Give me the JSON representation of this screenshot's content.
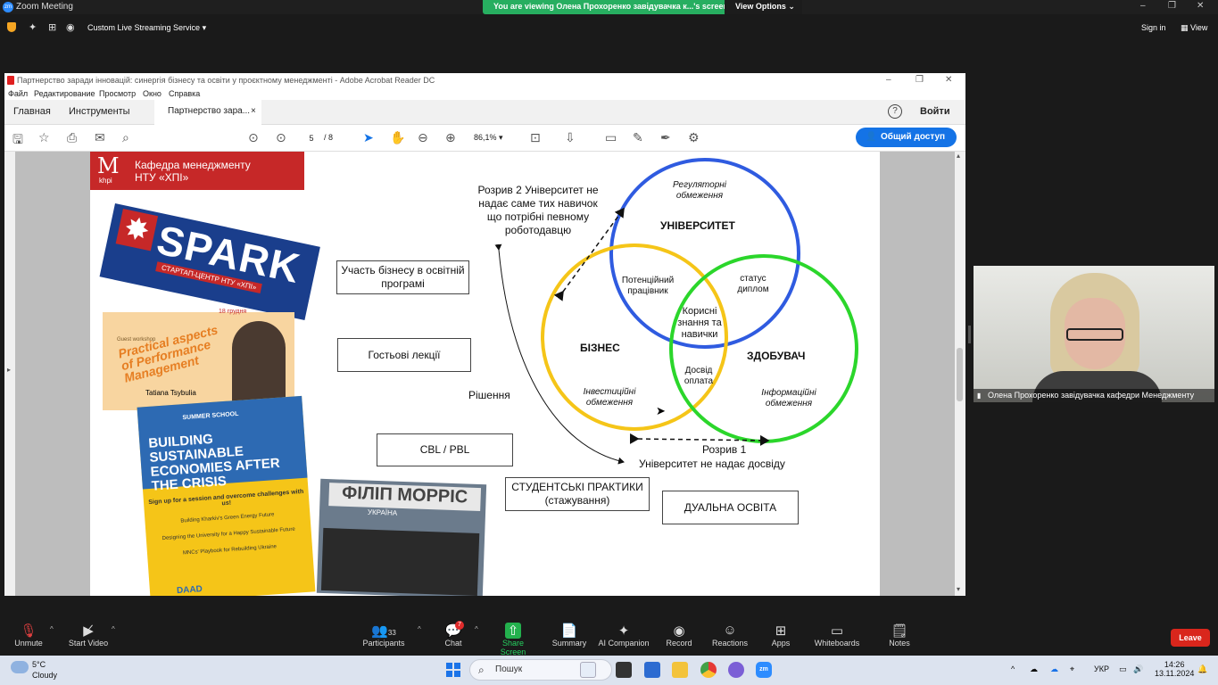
{
  "zoom_window": {
    "title": "Zoom Meeting",
    "logo": "zm",
    "minimize": "–",
    "restore": "❐",
    "close": "✕"
  },
  "share_banner": {
    "text": "You are viewing Олена Прохоренко завідувачка к...'s screen",
    "options": "View Options"
  },
  "zoom_toolbar": {
    "stream_label": "Custom Live Streaming Service",
    "sign_in": "Sign in",
    "view": "View"
  },
  "acrobat": {
    "title": "Партнерство заради інновацій: синергія бізнесу та освіти у проєктному менеджменті - Adobe Acrobat Reader DC",
    "menu": [
      "Файл",
      "Редактирование",
      "Просмотр",
      "Окно",
      "Справка"
    ],
    "tabs": {
      "home": "Главная",
      "tools": "Инструменты",
      "doc": "Партнерство зара...",
      "close": "×"
    },
    "help": "?",
    "login": "Войти",
    "page_current": "5",
    "page_total": "/ 8",
    "zoom": "86,1%",
    "share": "Общий доступ"
  },
  "slide": {
    "header": {
      "logo_m": "M",
      "logo_sub": "khpi",
      "line1": "Кафедра менеджменту",
      "line2": "НТУ «ХПІ»"
    },
    "spark": {
      "word": "SPARK",
      "subtitle": "СТАРТАП-ЦЕНТР НТУ «ХПІ»"
    },
    "flyer1": {
      "date": "18 грудня",
      "title": "Practical aspects of Performance Management",
      "name": "Tatiana Tsybulia",
      "tag": "Guest workshop"
    },
    "flyer2": {
      "label": "SUMMER SCHOOL",
      "title": "BUILDING SUSTAINABLE ECONOMIES AFTER THE CRISIS",
      "line1": "Sign up for a session and overcome challenges with us!",
      "line2": "Building Kharkiv's Green Energy Future",
      "line3": "Designing the University for a Happy Sustainable Future",
      "line4": "MNCs' Playbook for Rebuilding Ukraine",
      "footer": "DAAD"
    },
    "photo": {
      "sign": "ФІЛІП МОРРІС",
      "sub": "УКРАЇНА"
    },
    "boxes": {
      "b1": "Участь бізнесу в освітній програмі",
      "b2": "Гостьові лекції",
      "b3": "CBL / PBL",
      "b4": "СТУДЕНТСЬКІ ПРАКТИКИ (стажування)",
      "b5": "ДУАЛЬНА ОСВІТА"
    },
    "gap2": "Розрив 2 Університет не надає саме тих навичок що потрібні певному роботодавцю",
    "gap1_title": "Розрив 1",
    "gap1_text": "Університет не надає досвіду",
    "solution": "Рішення",
    "venn": {
      "university": "УНІВЕРСИТЕТ",
      "business": "БІЗНЕС",
      "student": "ЗДОБУВАЧ",
      "reg": "Регуляторні обмеження",
      "inv": "Інвестиційні обмеження",
      "info": "Інформаційні обмеження",
      "potential": "Потенційний працівник",
      "status": "статус диплом",
      "useful": "Корисні знання та навички",
      "exp": "Досвід оплата",
      "colors": {
        "university": "#2f5be0",
        "business": "#f5c518",
        "student": "#2bd62b"
      }
    }
  },
  "video": {
    "name": "Олена Прохоренко завідувачка кафедри Менеджменту"
  },
  "controls": {
    "unmute": "Unmute",
    "start_video": "Start Video",
    "participants": "Participants",
    "participants_count": "33",
    "chat": "Chat",
    "chat_badge": "7",
    "share": "Share Screen",
    "summary": "Summary",
    "companion": "AI Companion",
    "record": "Record",
    "reactions": "Reactions",
    "apps": "Apps",
    "whiteboards": "Whiteboards",
    "notes": "Notes",
    "leave": "Leave"
  },
  "taskbar": {
    "temp": "5°C",
    "cond": "Cloudy",
    "search": "Пошук",
    "lang": "УКР",
    "time": "14:26",
    "date": "13.11.2024"
  }
}
